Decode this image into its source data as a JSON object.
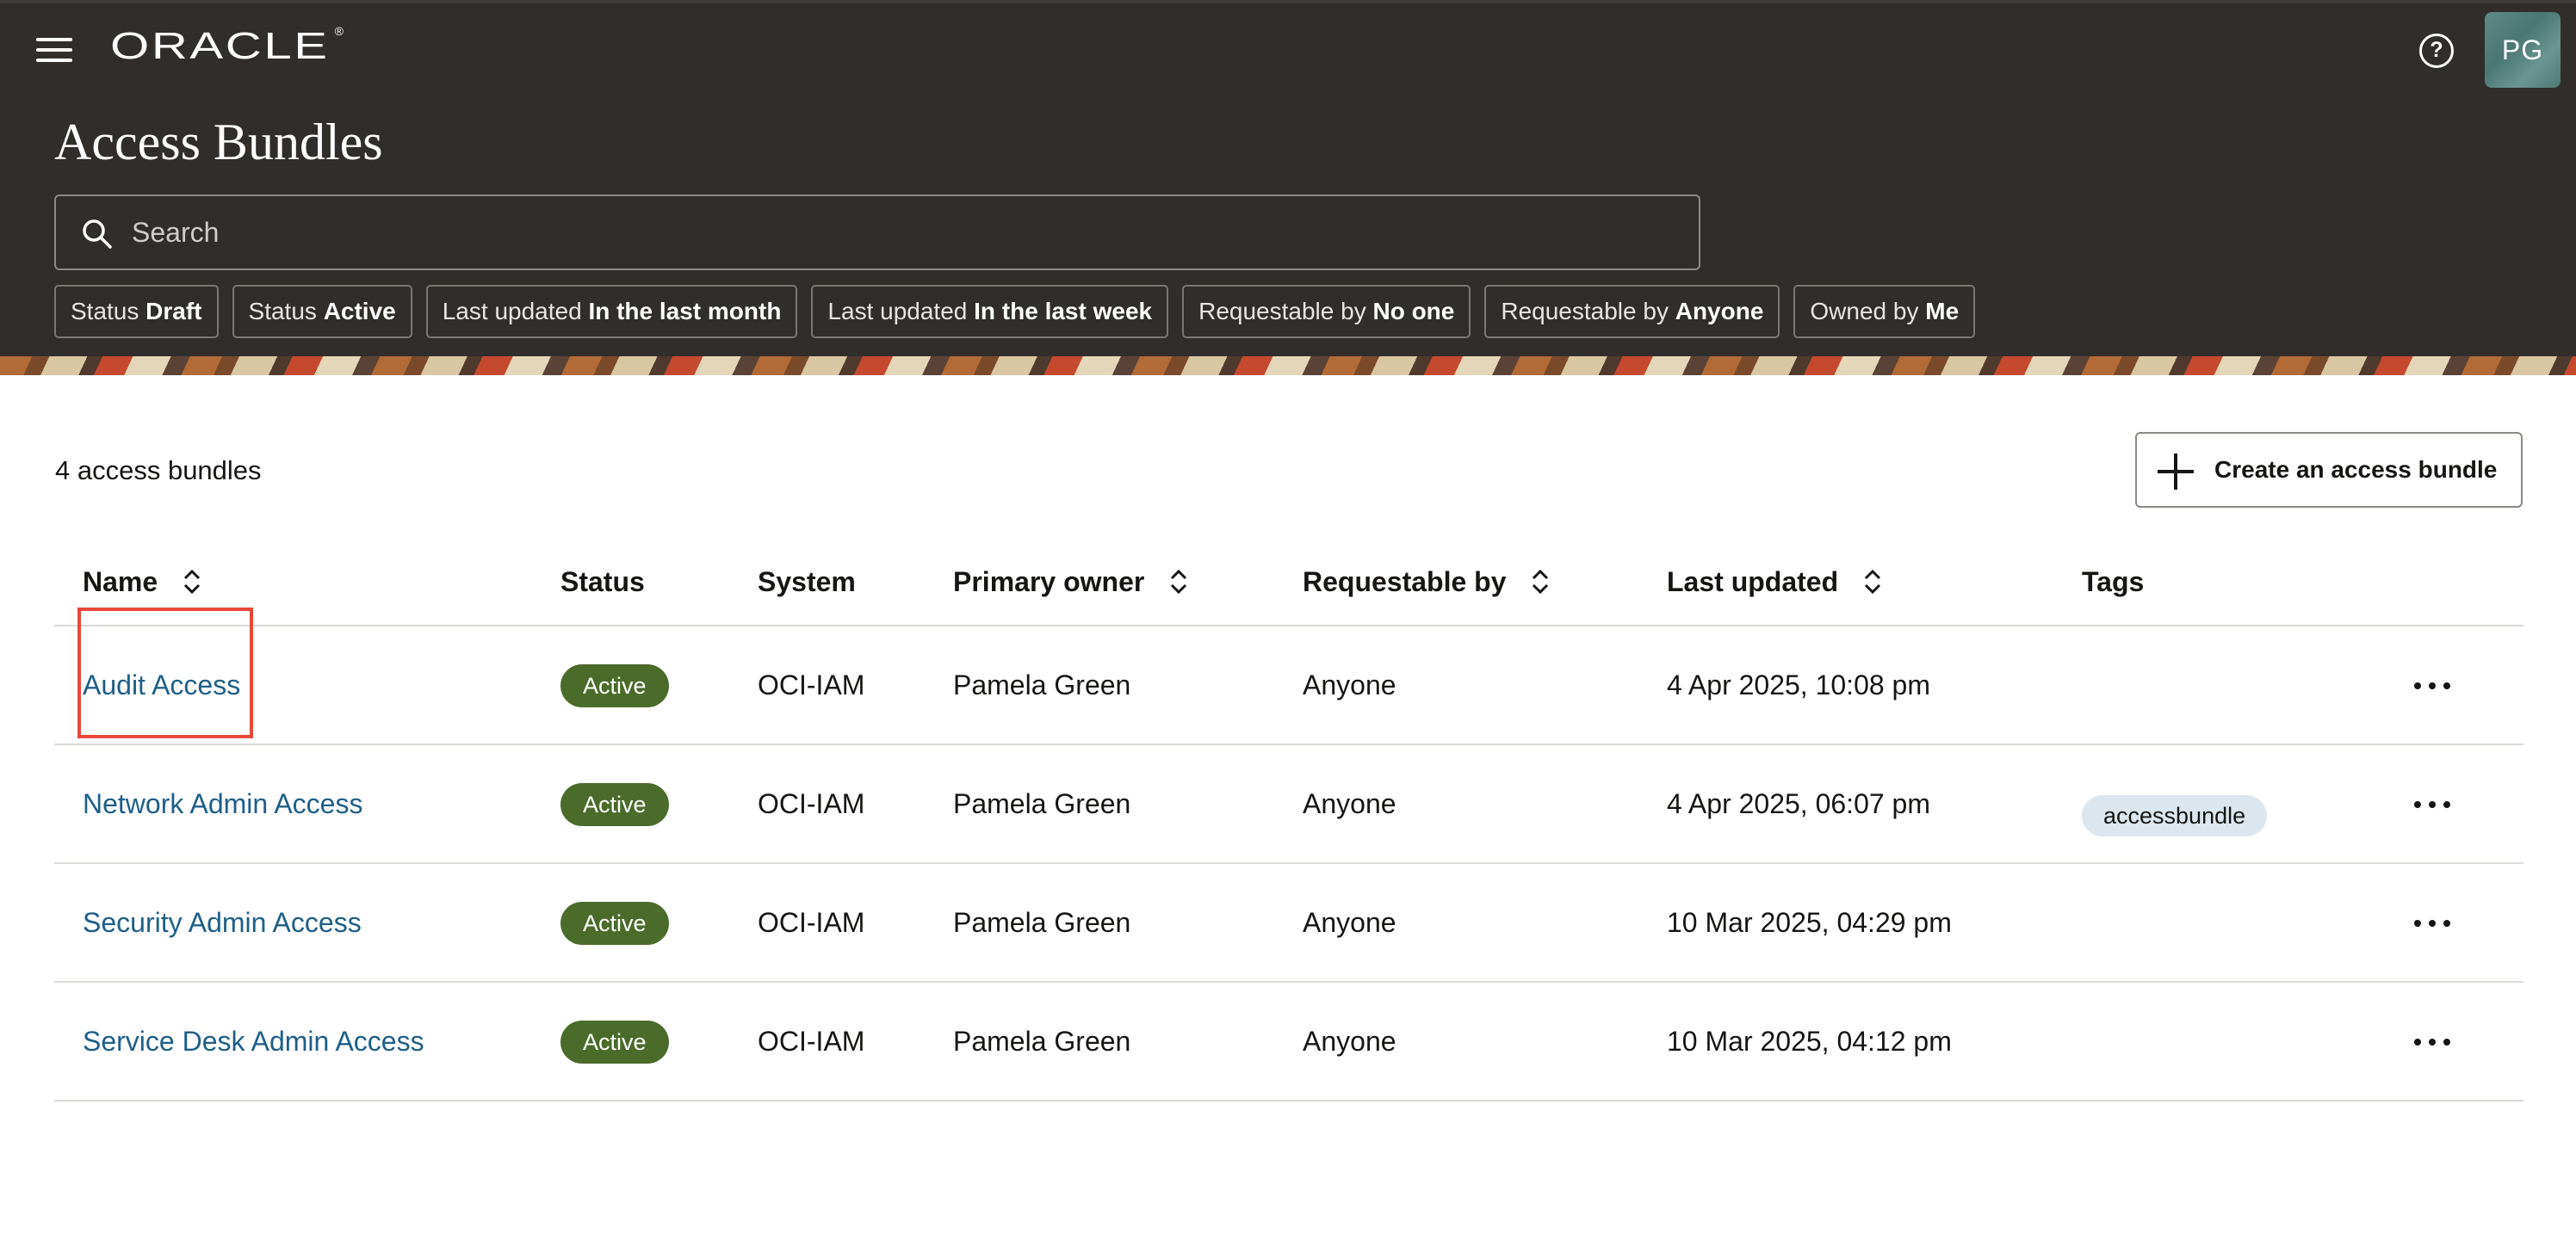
{
  "header": {
    "logo": "ORACLE",
    "help_icon": "help-icon",
    "avatar_initials": "PG",
    "page_title": "Access Bundles"
  },
  "search": {
    "placeholder": "Search",
    "value": ""
  },
  "filter_chips": [
    {
      "prefix": "Status",
      "value": "Draft"
    },
    {
      "prefix": "Status",
      "value": "Active"
    },
    {
      "prefix": "Last updated",
      "value": "In the last month"
    },
    {
      "prefix": "Last updated",
      "value": "In the last week"
    },
    {
      "prefix": "Requestable by",
      "value": "No one"
    },
    {
      "prefix": "Requestable by",
      "value": "Anyone"
    },
    {
      "prefix": "Owned by",
      "value": "Me"
    }
  ],
  "content": {
    "count_label": "4 access bundles",
    "create_button_label": "Create an access bundle"
  },
  "table": {
    "columns": {
      "name": "Name",
      "status": "Status",
      "system": "System",
      "primary_owner": "Primary owner",
      "requestable_by": "Requestable by",
      "last_updated": "Last updated",
      "tags": "Tags"
    },
    "rows": [
      {
        "name": "Audit Access",
        "status": "Active",
        "system": "OCI-IAM",
        "owner": "Pamela Green",
        "requestable_by": "Anyone",
        "last_updated": "4 Apr 2025, 10:08 pm",
        "tag": ""
      },
      {
        "name": "Network Admin Access",
        "status": "Active",
        "system": "OCI-IAM",
        "owner": "Pamela Green",
        "requestable_by": "Anyone",
        "last_updated": "4 Apr 2025, 06:07 pm",
        "tag": "accessbundle"
      },
      {
        "name": "Security Admin Access",
        "status": "Active",
        "system": "OCI-IAM",
        "owner": "Pamela Green",
        "requestable_by": "Anyone",
        "last_updated": "10 Mar 2025, 04:29 pm",
        "tag": ""
      },
      {
        "name": "Service Desk Admin Access",
        "status": "Active",
        "system": "OCI-IAM",
        "owner": "Pamela Green",
        "requestable_by": "Anyone",
        "last_updated": "10 Mar 2025, 04:12 pm",
        "tag": ""
      }
    ]
  },
  "colors": {
    "header_bg": "#312d2a",
    "link": "#1e5f88",
    "active_badge": "#4a6b2a",
    "tag_bg": "#dbe6ee",
    "highlight": "#e8483b"
  }
}
